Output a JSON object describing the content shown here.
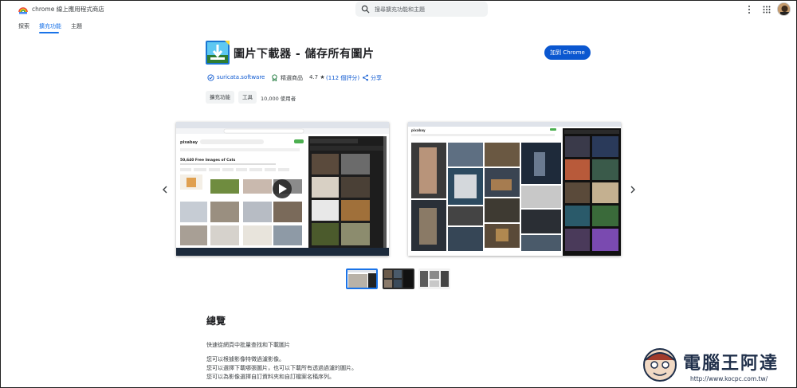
{
  "header": {
    "brand": "chrome 線上應用程式商店",
    "search_placeholder": "搜尋擴充功能和主題"
  },
  "tabs": [
    {
      "label": "探索"
    },
    {
      "label": "擴充功能"
    },
    {
      "label": "主題"
    }
  ],
  "extension": {
    "title": "圖片下載器 - 儲存所有圖片",
    "add_button": "加到 Chrome",
    "developer": "suricata.software",
    "featured": "精選商品",
    "rating": "4.7 ★",
    "review_count": "(112 個評分)",
    "share": "分享",
    "chips": [
      "擴充功能",
      "工具"
    ],
    "users": "10,000 使用者"
  },
  "screenshots": {
    "left_site": "pixabay",
    "left_heading": "50,640 Free Images of Cats",
    "right_site": "pixabay"
  },
  "overview": {
    "title": "總覽",
    "lines": [
      "快速從網頁中批量查找和下載圖片",
      "您可以根據影像特徵過濾影像。",
      "您可以選擇下載哪張圖片，也可以下載所有透過過濾的圖片。",
      "您可以為影像選擇自訂資料夾和自訂檔案名稱序列。"
    ]
  },
  "watermark": {
    "text": "電腦王阿達",
    "url": "http://www.kocpc.com.tw/"
  },
  "colors": {
    "accent": "#1a73e8",
    "button": "#0b57d0"
  }
}
